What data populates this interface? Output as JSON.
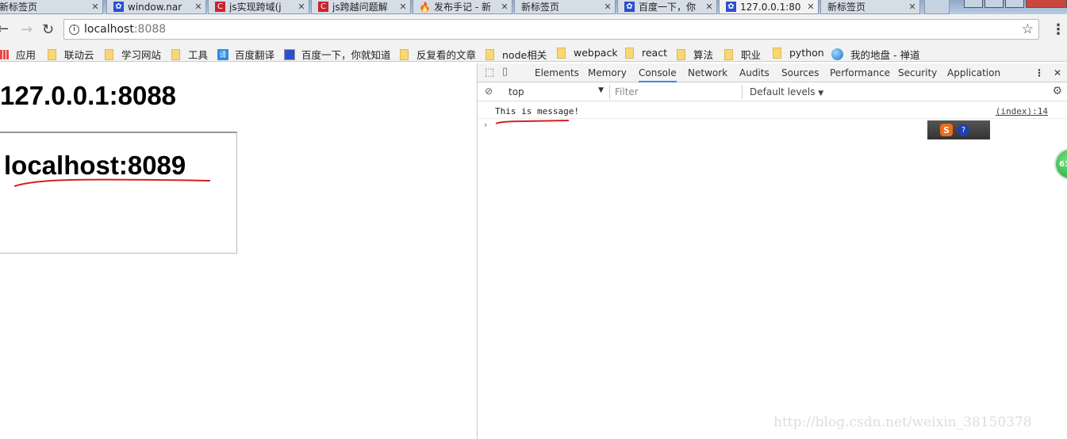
{
  "tabs": [
    {
      "title": "新标签页",
      "icon": "none"
    },
    {
      "title": "window.nar",
      "icon": "baidu-paw-icon"
    },
    {
      "title": "js实现跨域(j",
      "icon": "csdn-icon"
    },
    {
      "title": "js跨越问题解",
      "icon": "csdn-icon"
    },
    {
      "title": "发布手记 - 新",
      "icon": "flame-icon"
    },
    {
      "title": "新标签页",
      "icon": "none"
    },
    {
      "title": "百度一下，你",
      "icon": "baidu-paw-icon"
    },
    {
      "title": "127.0.0.1:80",
      "icon": "baidu-paw-icon",
      "active": true
    },
    {
      "title": "新标签页",
      "icon": "none"
    }
  ],
  "address": {
    "host": "localhost",
    "port": ":8088"
  },
  "bookmarks": [
    "应用",
    "联动云",
    "学习网站",
    "工具",
    "百度翻译",
    "百度一下，你就知道",
    "反复看的文章",
    "node相关",
    "webpack",
    "react",
    "算法",
    "职业",
    "python",
    "我的地盘 - 禅道"
  ],
  "page": {
    "heading": "127.0.0.1:8088",
    "iframe_heading": "localhost:8089"
  },
  "devtools": {
    "tabs": [
      "Elements",
      "Memory",
      "Console",
      "Network",
      "Audits",
      "Sources",
      "Performance",
      "Security",
      "Application"
    ],
    "active_tab": "Console",
    "context": "top",
    "filter_placeholder": "Filter",
    "levels": "Default levels",
    "message": "This is message!",
    "source": "(index):14"
  },
  "badge": "63",
  "watermark": "http://blog.csdn.net/weixin_38150378",
  "colors": {
    "annotation": "#d42020",
    "accent": "#3e82f7"
  }
}
